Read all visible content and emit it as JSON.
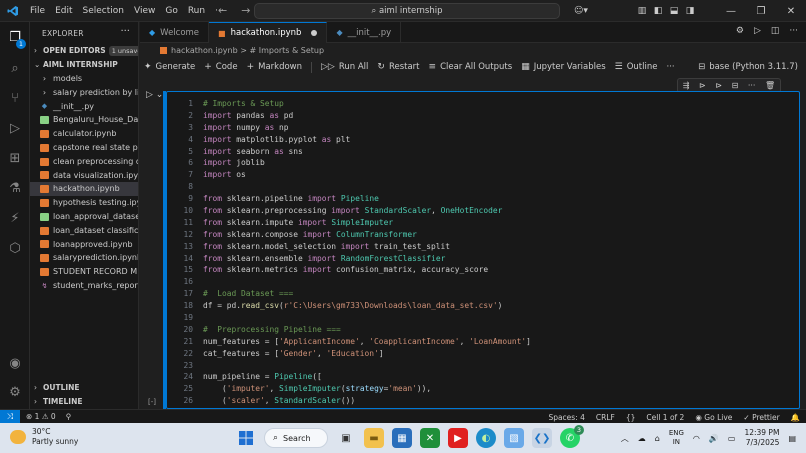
{
  "titlebar": {
    "menu": [
      "File",
      "Edit",
      "Selection",
      "View",
      "Go",
      "Run",
      "···"
    ],
    "search_text": "aiml internship",
    "icons": [
      "vscode-logo-icon",
      "back-arrow-icon",
      "forward-arrow-icon",
      "copilot-icon",
      "layout-icon",
      "toggle-sidebar-icon",
      "toggle-panel-icon",
      "toggle-secondary-icon",
      "minimize-icon",
      "maximize-icon",
      "close-icon"
    ]
  },
  "activitybar": {
    "badge": "1",
    "items": [
      "explorer-icon",
      "search-icon",
      "source-control-icon",
      "run-debug-icon",
      "extensions-icon",
      "testing-icon",
      "jupyter-icon",
      "remote-explorer-icon",
      "account-icon",
      "settings-icon"
    ]
  },
  "sidebar": {
    "title": "EXPLORER",
    "more": "···",
    "open_editors": "OPEN EDITORS",
    "unsaved": "1 unsaved",
    "folder": "AIML INTERNSHIP",
    "items": [
      {
        "label": "models",
        "type": "folder"
      },
      {
        "label": "salary prediction by li...",
        "type": "folder"
      },
      {
        "label": "__init__.py",
        "type": "py"
      },
      {
        "label": "Bengaluru_House_Dat...",
        "type": "csv"
      },
      {
        "label": "calculator.ipynb",
        "type": "nb"
      },
      {
        "label": "capstone real state pr...",
        "type": "nb"
      },
      {
        "label": "clean preprocessing d...",
        "type": "nb"
      },
      {
        "label": "data visualization.ipynb",
        "type": "nb"
      },
      {
        "label": "hackathon.ipynb",
        "type": "nb",
        "selected": true
      },
      {
        "label": "hypothesis testing.ipy...",
        "type": "nb"
      },
      {
        "label": "loan_approval_datase...",
        "type": "csv"
      },
      {
        "label": "loan_dataset classifica...",
        "type": "nb"
      },
      {
        "label": "loanapproved.ipynb",
        "type": "nb"
      },
      {
        "label": "salaryprediction.ipynb",
        "type": "nb"
      },
      {
        "label": "STUDENT RECORD M...",
        "type": "nb"
      },
      {
        "label": "student_marks_report...",
        "type": "st"
      }
    ],
    "outline": "OUTLINE",
    "timeline": "TIMELINE"
  },
  "tabs": [
    {
      "label": "Welcome",
      "active": false
    },
    {
      "label": "hackathon.ipynb",
      "active": true,
      "dirty": true
    },
    {
      "label": "__init__.py",
      "active": false
    }
  ],
  "breadcrumb": {
    "file": "hackathon.ipynb",
    "sep": ">",
    "hash": "#",
    "section": "Imports & Setup"
  },
  "toolbar": {
    "generate": "Generate",
    "code": "Code",
    "markdown": "Markdown",
    "run_all": "Run All",
    "restart": "Restart",
    "clear_outputs": "Clear All Outputs",
    "variables": "Jupyter Variables",
    "outline": "Outline",
    "more": "···",
    "kernel": "base (Python 3.11.7)"
  },
  "cell": {
    "exec_label": "[-]",
    "lines": [
      [
        [
          "c-cm",
          "# Imports & Setup"
        ]
      ],
      [
        [
          "c-kw",
          "import"
        ],
        [
          "",
          " pandas "
        ],
        [
          "c-kw",
          "as"
        ],
        [
          "",
          " pd"
        ]
      ],
      [
        [
          "c-kw",
          "import"
        ],
        [
          "",
          " numpy "
        ],
        [
          "c-kw",
          "as"
        ],
        [
          "",
          " np"
        ]
      ],
      [
        [
          "c-kw",
          "import"
        ],
        [
          "",
          " matplotlib.pyplot "
        ],
        [
          "c-kw",
          "as"
        ],
        [
          "",
          " plt"
        ]
      ],
      [
        [
          "c-kw",
          "import"
        ],
        [
          "",
          " seaborn "
        ],
        [
          "c-kw",
          "as"
        ],
        [
          "",
          " sns"
        ]
      ],
      [
        [
          "c-kw",
          "import"
        ],
        [
          "",
          " joblib"
        ]
      ],
      [
        [
          "c-kw",
          "import"
        ],
        [
          "",
          " os"
        ]
      ],
      [],
      [
        [
          "c-kw",
          "from"
        ],
        [
          "",
          " sklearn.pipeline "
        ],
        [
          "c-kw",
          "import"
        ],
        [
          "",
          " "
        ],
        [
          "c-cl",
          "Pipeline"
        ]
      ],
      [
        [
          "c-kw",
          "from"
        ],
        [
          "",
          " sklearn.preprocessing "
        ],
        [
          "c-kw",
          "import"
        ],
        [
          "",
          " "
        ],
        [
          "c-cl",
          "StandardScaler"
        ],
        [
          "",
          ", "
        ],
        [
          "c-cl",
          "OneHotEncoder"
        ]
      ],
      [
        [
          "c-kw",
          "from"
        ],
        [
          "",
          " sklearn.impute "
        ],
        [
          "c-kw",
          "import"
        ],
        [
          "",
          " "
        ],
        [
          "c-cl",
          "SimpleImputer"
        ]
      ],
      [
        [
          "c-kw",
          "from"
        ],
        [
          "",
          " sklearn.compose "
        ],
        [
          "c-kw",
          "import"
        ],
        [
          "",
          " "
        ],
        [
          "c-cl",
          "ColumnTransformer"
        ]
      ],
      [
        [
          "c-kw",
          "from"
        ],
        [
          "",
          " sklearn.model_selection "
        ],
        [
          "c-kw",
          "import"
        ],
        [
          "",
          " train_test_split"
        ]
      ],
      [
        [
          "c-kw",
          "from"
        ],
        [
          "",
          " sklearn.ensemble "
        ],
        [
          "c-kw",
          "import"
        ],
        [
          "",
          " "
        ],
        [
          "c-cl",
          "RandomForestClassifier"
        ]
      ],
      [
        [
          "c-kw",
          "from"
        ],
        [
          "",
          " sklearn.metrics "
        ],
        [
          "c-kw",
          "import"
        ],
        [
          "",
          " confusion_matrix, accuracy_score"
        ]
      ],
      [],
      [
        [
          "c-cm",
          "#  Load Dataset ==="
        ]
      ],
      [
        [
          "",
          "df = pd."
        ],
        [
          "c-fn",
          "read_csv"
        ],
        [
          "",
          "("
        ],
        [
          "c-st",
          "r'C:\\Users\\gm733\\Downloads\\loan_data_set.csv'"
        ],
        [
          "",
          ")"
        ]
      ],
      [],
      [
        [
          "c-cm",
          "#  Preprocessing Pipeline ==="
        ]
      ],
      [
        [
          "",
          "num_features = ["
        ],
        [
          "c-st",
          "'ApplicantIncome'"
        ],
        [
          "",
          ", "
        ],
        [
          "c-st",
          "'CoapplicantIncome'"
        ],
        [
          "",
          ", "
        ],
        [
          "c-st",
          "'LoanAmount'"
        ],
        [
          "",
          "]"
        ]
      ],
      [
        [
          "",
          "cat_features = ["
        ],
        [
          "c-st",
          "'Gender'"
        ],
        [
          "",
          ", "
        ],
        [
          "c-st",
          "'Education'"
        ],
        [
          "",
          "]"
        ]
      ],
      [],
      [
        [
          "",
          "num_pipeline = "
        ],
        [
          "c-cl",
          "Pipeline"
        ],
        [
          "",
          "(["
        ]
      ],
      [
        [
          "",
          "    ("
        ],
        [
          "c-st",
          "'imputer'"
        ],
        [
          "",
          ", "
        ],
        [
          "c-cl",
          "SimpleImputer"
        ],
        [
          "",
          "("
        ],
        [
          "c-vr",
          "strategy"
        ],
        [
          "",
          "="
        ],
        [
          "c-st",
          "'mean'"
        ],
        [
          "",
          ")),"
        ]
      ],
      [
        [
          "",
          "    ("
        ],
        [
          "c-st",
          "'scaler'"
        ],
        [
          "",
          ", "
        ],
        [
          "c-cl",
          "StandardScaler"
        ],
        [
          "",
          "())"
        ]
      ]
    ]
  },
  "statusbar": {
    "errors": "⊗ 1 ⚠ 0",
    "spaces": "Spaces: 4",
    "eol": "CRLF",
    "braces": "{}",
    "cell": "Cell 1 of 2",
    "golive": "Go Live",
    "prettier": "Prettier"
  },
  "taskbar": {
    "temp": "30°C",
    "weather": "Partly sunny",
    "search": "Search",
    "lang1": "ENG",
    "lang2": "IN",
    "time": "12:39 PM",
    "date": "7/3/2025",
    "vscode_badge": "3"
  }
}
